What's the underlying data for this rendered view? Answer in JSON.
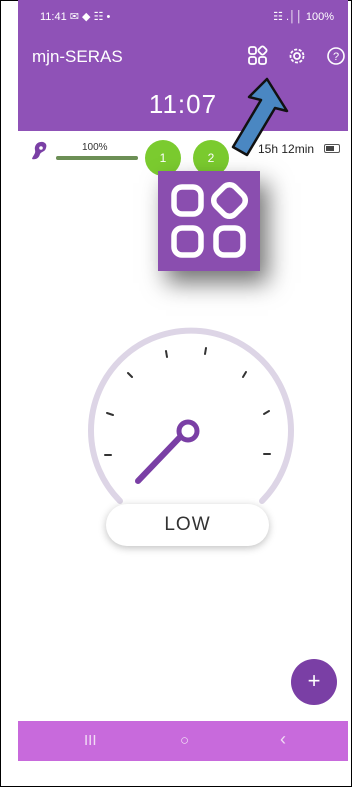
{
  "status_bar": {
    "time": "11:41",
    "left_indicators": "✉ ◆ ☷ •",
    "right_indicators": "☷ .││ 100%"
  },
  "header": {
    "app_name": "mjn-SERAS",
    "clock": "11:07"
  },
  "battery": {
    "label": "100%",
    "fraction": 1.0
  },
  "hearing_aids": [
    {
      "label": "1"
    },
    {
      "label": "2"
    }
  ],
  "time_remaining": "15h 12min",
  "mode": {
    "label": "LOW"
  },
  "fab_label": "+",
  "nav": {
    "recent": "III",
    "home": "○",
    "back": "‹"
  },
  "colors": {
    "brand": "#8f52b7",
    "green": "#7bcb2f",
    "navbar": "#c86adc",
    "arrow": "#4a87c2"
  }
}
